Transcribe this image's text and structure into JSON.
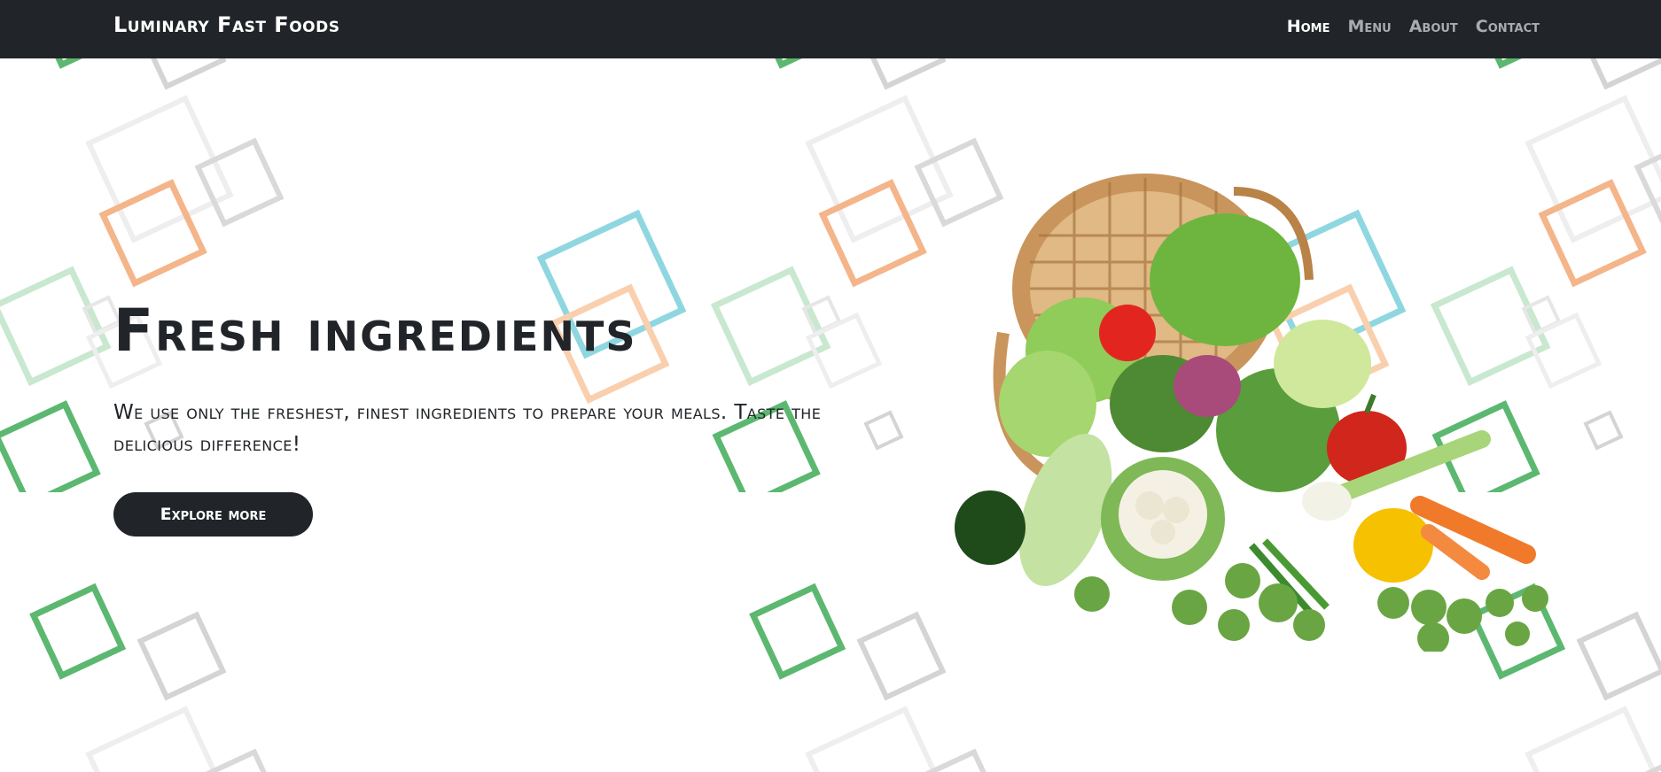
{
  "navbar": {
    "brand": "Luminary Fast Foods",
    "links": [
      {
        "label": "Home",
        "active": true
      },
      {
        "label": "Menu",
        "active": false
      },
      {
        "label": "About",
        "active": false
      },
      {
        "label": "Contact",
        "active": false
      }
    ]
  },
  "hero": {
    "title": "Fresh ingredients",
    "text": "We use only the freshest, finest ingredients to prepare your meals. Taste the delicious difference!",
    "button_label": "Explore more",
    "image_icon": "vegetable-basket-illustration"
  },
  "colors": {
    "navbar_bg": "#212529",
    "text_dark": "#212529",
    "pattern_green": "#5cb870",
    "pattern_orange": "#f4b58a",
    "pattern_blue": "#8fd7e0",
    "pattern_gray": "#d0d0d0"
  }
}
